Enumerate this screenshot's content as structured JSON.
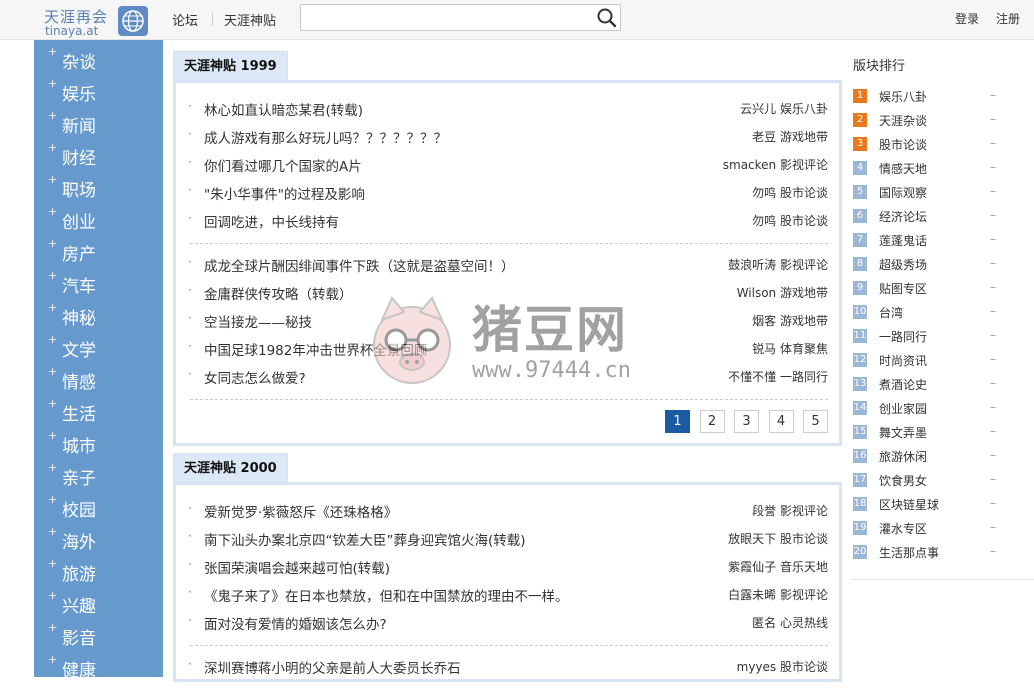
{
  "header": {
    "logo_cn": "天涯再会",
    "logo_en": "tinaya.at",
    "nav": [
      "论坛",
      "天涯神贴"
    ],
    "search_placeholder": "",
    "login": "登录",
    "register": "注册"
  },
  "sidebar": {
    "items": [
      "杂谈",
      "娱乐",
      "新闻",
      "财经",
      "职场",
      "创业",
      "房产",
      "汽车",
      "神秘",
      "文学",
      "情感",
      "生活",
      "城市",
      "亲子",
      "校园",
      "海外",
      "旅游",
      "兴趣",
      "影音",
      "健康"
    ]
  },
  "sections": [
    {
      "title": "天涯神贴 1999",
      "groups": [
        [
          {
            "title": "林心如直认暗恋某君(转载)",
            "author": "云兴儿",
            "board": "娱乐八卦"
          },
          {
            "title": "成人游戏有那么好玩儿吗？？？？？？？",
            "author": "老豆",
            "board": "游戏地带"
          },
          {
            "title": "你们看过哪几个国家的A片",
            "author": "smacken",
            "board": "影视评论"
          },
          {
            "title": "\"朱小华事件\"的过程及影响",
            "author": "勿鸣",
            "board": "股市论谈"
          },
          {
            "title": "回调吃进，中长线持有",
            "author": "勿鸣",
            "board": "股市论谈"
          }
        ],
        [
          {
            "title": "成龙全球片酬因绯闻事件下跌（这就是盗墓空间！）",
            "author": "鼓浪听涛",
            "board": "影视评论"
          },
          {
            "title": "金庸群侠传攻略（转载）",
            "author": "Wilson",
            "board": "游戏地带"
          },
          {
            "title": "空当接龙——秘技",
            "author": "烟客",
            "board": "游戏地带"
          },
          {
            "title": "中国足球1982年冲击世界杯全景回顾",
            "author": "锐马",
            "board": "体育聚焦"
          },
          {
            "title": "女同志怎么做爱?",
            "author": "不懂不懂",
            "board": "一路同行"
          }
        ]
      ],
      "pages": [
        "1",
        "2",
        "3",
        "4",
        "5"
      ],
      "active_page": "1"
    },
    {
      "title": "天涯神贴 2000",
      "groups": [
        [
          {
            "title": "爱新觉罗·紫薇怒斥《还珠格格》",
            "author": "段誉",
            "board": "影视评论"
          },
          {
            "title": "南下汕头办案北京四“钦差大臣”葬身迎宾馆火海(转载)",
            "author": "放眼天下",
            "board": "股市论谈"
          },
          {
            "title": "张国荣演唱会越来越可怕(转载)",
            "author": "紫霞仙子",
            "board": "音乐天地"
          },
          {
            "title": "《鬼子来了》在日本也禁放，但和在中国禁放的理由不一样。",
            "author": "白露未晞",
            "board": "影视评论"
          },
          {
            "title": "面对没有爱情的婚姻该怎么办?",
            "author": "匿名",
            "board": "心灵热线"
          }
        ],
        [
          {
            "title": "深圳赛博蒋小明的父亲是前人大委员长乔石",
            "author": "myyes",
            "board": "股市论谈"
          }
        ]
      ]
    }
  ],
  "ranking": {
    "title": "版块排行",
    "items": [
      "娱乐八卦",
      "天涯杂谈",
      "股市论谈",
      "情感天地",
      "国际观察",
      "经济论坛",
      "莲蓬鬼话",
      "超级秀场",
      "贴图专区",
      "台湾",
      "一路同行",
      "时尚资讯",
      "煮酒论史",
      "创业家园",
      "舞文弄墨",
      "旅游休闲",
      "饮食男女",
      "区块链星球",
      "灌水专区",
      "生活那点事"
    ],
    "dash": "–"
  },
  "watermark": {
    "text": "猪豆网",
    "url": "www.97444.cn"
  },
  "colors": {
    "sidebar": "#6699cc",
    "accent": "#1c5ba3",
    "hot_rank": "#e8791c"
  }
}
